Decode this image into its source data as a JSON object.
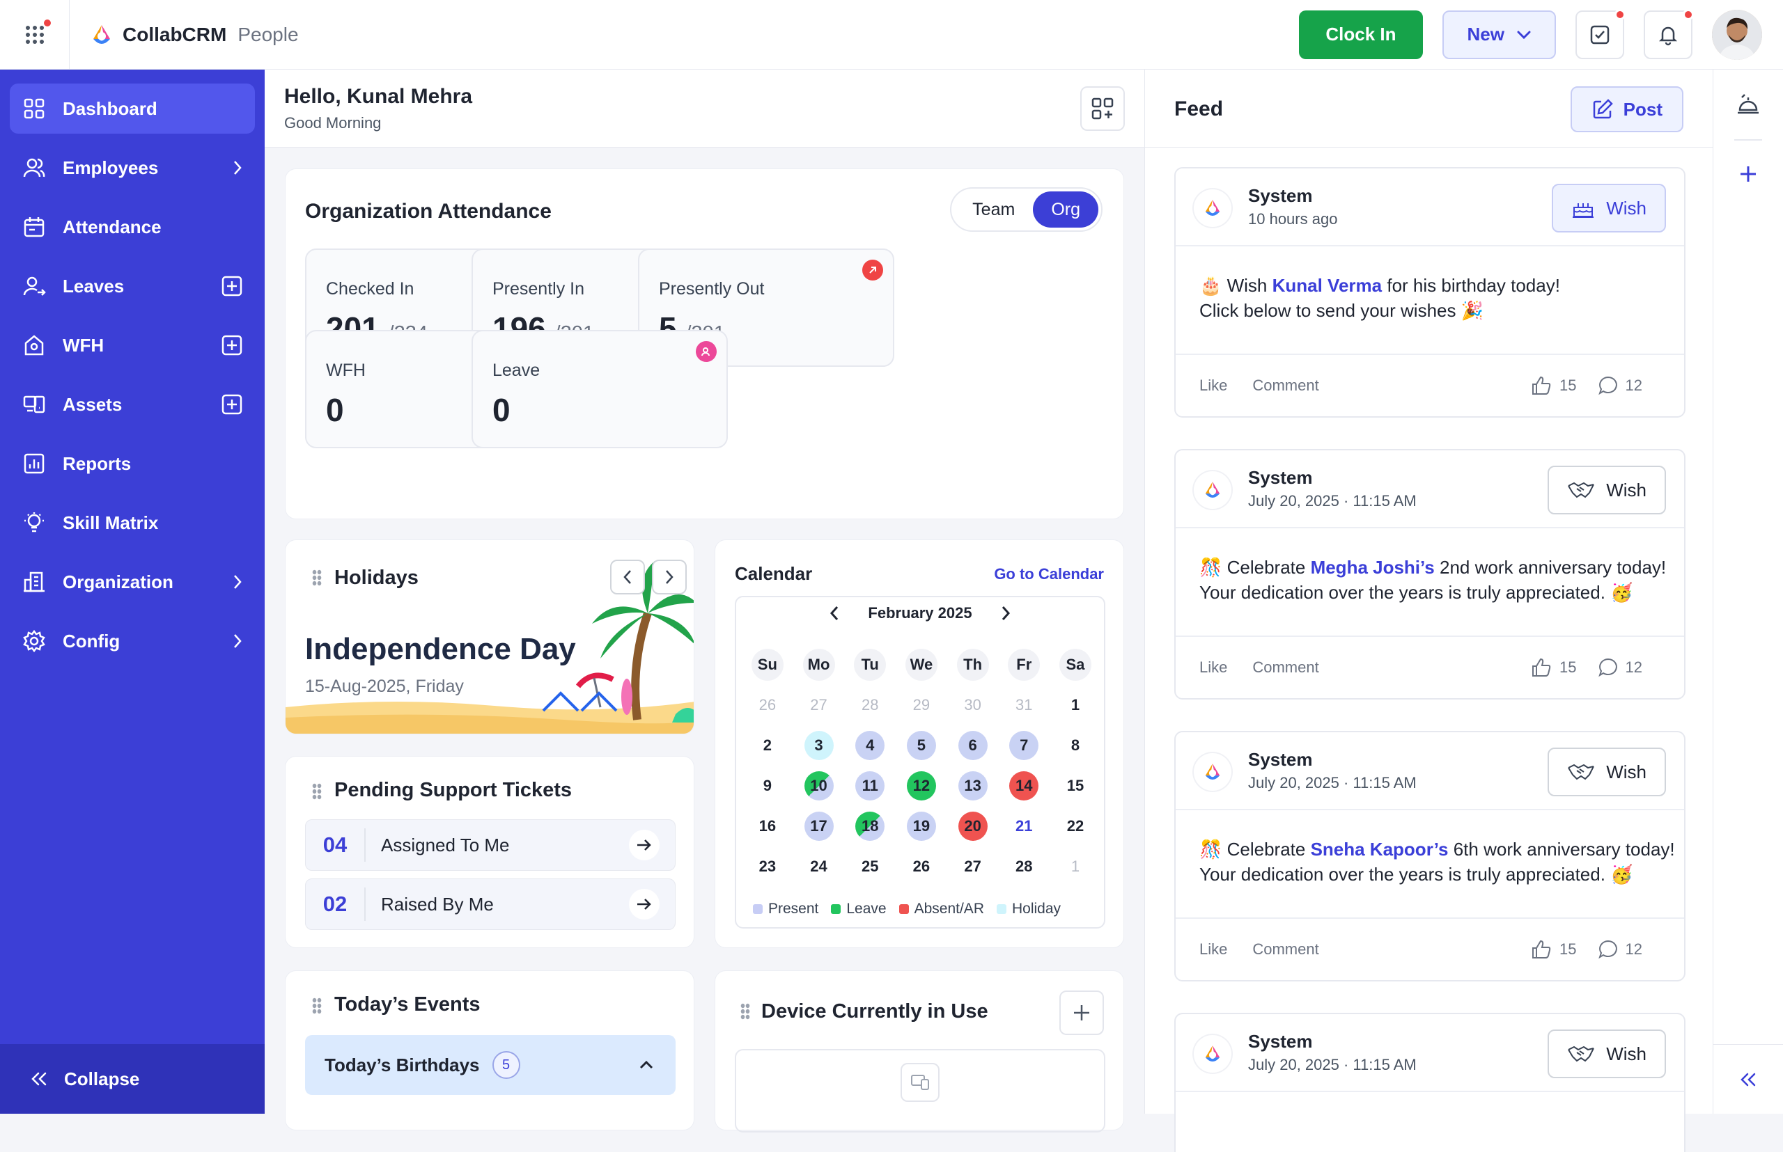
{
  "brand": {
    "name": "CollabCRM",
    "module": "People"
  },
  "topbar": {
    "clock_in": "Clock In",
    "new": "New"
  },
  "sidebar": {
    "items": [
      {
        "label": "Dashboard",
        "icon": "dashboard-icon",
        "trail": "",
        "active": true
      },
      {
        "label": "Employees",
        "icon": "users-icon",
        "trail": "chevron"
      },
      {
        "label": "Attendance",
        "icon": "calendar-icon",
        "trail": ""
      },
      {
        "label": "Leaves",
        "icon": "user-leave-icon",
        "trail": "plus"
      },
      {
        "label": "WFH",
        "icon": "home-icon",
        "trail": "plus"
      },
      {
        "label": "Assets",
        "icon": "assets-icon",
        "trail": "plus"
      },
      {
        "label": "Reports",
        "icon": "reports-icon",
        "trail": ""
      },
      {
        "label": "Skill Matrix",
        "icon": "bulb-icon",
        "trail": ""
      },
      {
        "label": "Organization",
        "icon": "building-icon",
        "trail": "chevron"
      },
      {
        "label": "Config",
        "icon": "gear-icon",
        "trail": "chevron"
      }
    ],
    "collapse": "Collapse"
  },
  "header": {
    "greeting": "Hello, Kunal Mehra",
    "sub": "Good Morning"
  },
  "attendance": {
    "title": "Organization Attendance",
    "toggle": [
      "Team",
      "Org"
    ],
    "stats": [
      {
        "label": "Checked In",
        "value": "201",
        "total": "/234",
        "color": "#5b63e8"
      },
      {
        "label": "Presently In",
        "value": "196",
        "total": "/201",
        "color": "#16a34a"
      },
      {
        "label": "Presently Out",
        "value": "5",
        "total": "/201",
        "color": "#ef4444"
      },
      {
        "label": "WFH",
        "value": "0",
        "total": "",
        "color": "#f59e0b"
      },
      {
        "label": "Leave",
        "value": "0",
        "total": "",
        "color": "#ec4899"
      }
    ]
  },
  "holidays": {
    "title": "Holidays",
    "name": "Independence Day",
    "date": "15-Aug-2025, Friday"
  },
  "tickets": {
    "title": "Pending Support Tickets",
    "rows": [
      {
        "num": "04",
        "label": "Assigned To Me"
      },
      {
        "num": "02",
        "label": "Raised By Me"
      }
    ]
  },
  "events": {
    "title": "Today’s Events",
    "birthdays_label": "Today’s Birthdays",
    "birthdays_count": "5"
  },
  "calendar": {
    "title": "Calendar",
    "link": "Go to Calendar",
    "month": "February 2025",
    "dow": [
      "Su",
      "Mo",
      "Tu",
      "We",
      "Th",
      "Fr",
      "Sa"
    ],
    "weeks": [
      [
        {
          "d": "26",
          "s": "muted"
        },
        {
          "d": "27",
          "s": "muted"
        },
        {
          "d": "28",
          "s": "muted"
        },
        {
          "d": "29",
          "s": "muted"
        },
        {
          "d": "30",
          "s": "muted"
        },
        {
          "d": "31",
          "s": "muted"
        },
        {
          "d": "1",
          "s": "plain"
        }
      ],
      [
        {
          "d": "2",
          "s": "plain"
        },
        {
          "d": "3",
          "s": "holiday"
        },
        {
          "d": "4",
          "s": "present"
        },
        {
          "d": "5",
          "s": "present"
        },
        {
          "d": "6",
          "s": "present"
        },
        {
          "d": "7",
          "s": "present"
        },
        {
          "d": "8",
          "s": "plain"
        }
      ],
      [
        {
          "d": "9",
          "s": "plain"
        },
        {
          "d": "10",
          "s": "half"
        },
        {
          "d": "11",
          "s": "present"
        },
        {
          "d": "12",
          "s": "leave"
        },
        {
          "d": "13",
          "s": "present"
        },
        {
          "d": "14",
          "s": "absent"
        },
        {
          "d": "15",
          "s": "plain"
        }
      ],
      [
        {
          "d": "16",
          "s": "plain"
        },
        {
          "d": "17",
          "s": "present"
        },
        {
          "d": "18",
          "s": "half"
        },
        {
          "d": "19",
          "s": "present"
        },
        {
          "d": "20",
          "s": "absent"
        },
        {
          "d": "21",
          "s": "today"
        },
        {
          "d": "22",
          "s": "plain"
        }
      ],
      [
        {
          "d": "23",
          "s": "plain"
        },
        {
          "d": "24",
          "s": "plain"
        },
        {
          "d": "25",
          "s": "plain"
        },
        {
          "d": "26",
          "s": "plain"
        },
        {
          "d": "27",
          "s": "plain"
        },
        {
          "d": "28",
          "s": "plain"
        },
        {
          "d": "1",
          "s": "muted"
        }
      ]
    ],
    "legend": [
      {
        "label": "Present",
        "color": "#c7cdf5"
      },
      {
        "label": "Leave",
        "color": "#22c55e"
      },
      {
        "label": "Absent/AR",
        "color": "#ef5350"
      },
      {
        "label": "Holiday",
        "color": "#cff4fc"
      }
    ]
  },
  "device": {
    "title": "Device Currently in Use"
  },
  "feed": {
    "title": "Feed",
    "post": "Post",
    "cards": [
      {
        "name": "System",
        "time": "10 hours ago",
        "wish": "Wish",
        "pre": "🎂 Wish ",
        "person": "Kunal Verma",
        "post": " for his birthday today!",
        "line2": "Click below to send your wishes 🎉",
        "like": "Like",
        "comment": "Comment",
        "likes": "15",
        "comments": "12"
      },
      {
        "name": "System",
        "time": "July 20, 2025 · 11:15 AM",
        "wish": "Wish",
        "pre": "🎊 Celebrate ",
        "person": "Megha Joshi’s",
        "post": " 2nd work anniversary today!",
        "line2": "Your dedication over the years is truly appreciated. 🥳",
        "like": "Like",
        "comment": "Comment",
        "likes": "15",
        "comments": "12"
      },
      {
        "name": "System",
        "time": "July 20, 2025 · 11:15 AM",
        "wish": "Wish",
        "pre": "🎊 Celebrate ",
        "person": "Sneha Kapoor’s",
        "post": " 6th work anniversary today!",
        "line2": "Your dedication over the years is truly appreciated. 🥳",
        "like": "Like",
        "comment": "Comment",
        "likes": "15",
        "comments": "12"
      },
      {
        "name": "System",
        "time": "July 20, 2025 · 11:15 AM",
        "wish": "Wish"
      }
    ]
  }
}
